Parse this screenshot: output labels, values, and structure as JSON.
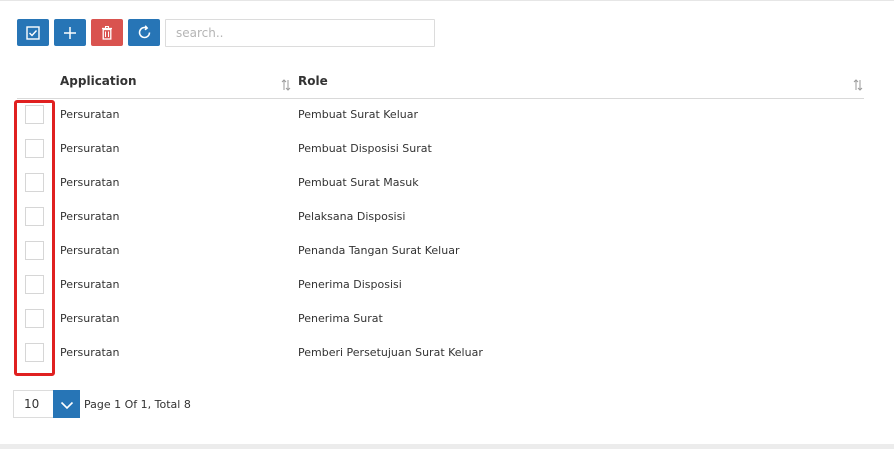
{
  "toolbar": {
    "buttons": [
      {
        "icon": "checkbox-check-icon"
      },
      {
        "icon": "plus-icon"
      },
      {
        "icon": "trash-icon"
      },
      {
        "icon": "refresh-icon"
      }
    ],
    "search_placeholder": "search.."
  },
  "table": {
    "columns": [
      "Application",
      "Role"
    ],
    "rows": [
      {
        "application": "Persuratan",
        "role": "Pembuat Surat Keluar"
      },
      {
        "application": "Persuratan",
        "role": "Pembuat Disposisi Surat"
      },
      {
        "application": "Persuratan",
        "role": "Pembuat Surat Masuk"
      },
      {
        "application": "Persuratan",
        "role": "Pelaksana Disposisi"
      },
      {
        "application": "Persuratan",
        "role": "Penanda Tangan Surat Keluar"
      },
      {
        "application": "Persuratan",
        "role": "Penerima Disposisi"
      },
      {
        "application": "Persuratan",
        "role": "Penerima Surat"
      },
      {
        "application": "Persuratan",
        "role": "Pemberi Persetujuan Surat Keluar"
      }
    ]
  },
  "pagination": {
    "page_size": "10",
    "info": "Page 1 Of 1, Total 8"
  },
  "colors": {
    "primary": "#2775b6",
    "danger": "#d9534f",
    "highlight": "#e02020"
  }
}
